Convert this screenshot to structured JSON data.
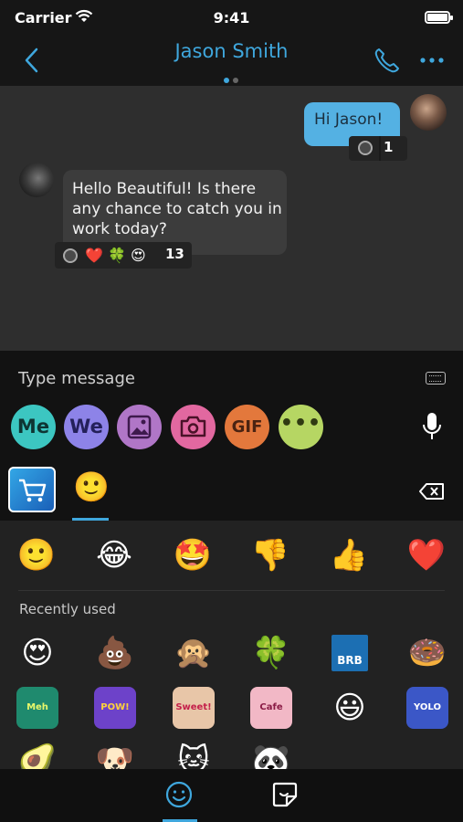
{
  "status_bar": {
    "carrier": "Carrier",
    "time": "9:41"
  },
  "header": {
    "title": "Jason Smith",
    "page_dots": 2,
    "active_dot": 0,
    "accent": "#3fa7dd"
  },
  "messages": [
    {
      "direction": "outgoing",
      "text": "Hi Jason!",
      "reaction_count": "1",
      "reaction_icons": [
        "camera-sticker-icon"
      ]
    },
    {
      "direction": "incoming",
      "text": "Hello Beautiful! Is there any chance to catch you in work today?",
      "reaction_count": "13",
      "reaction_icons": [
        "camera-sticker-icon",
        "❤️",
        "🍀",
        "😍"
      ]
    }
  ],
  "composer": {
    "placeholder": "Type message",
    "actions": [
      {
        "label": "Me",
        "color": "#3cc6c1"
      },
      {
        "label": "We",
        "color": "#8d83e8"
      },
      {
        "icon": "image-icon",
        "color": "#b076c7"
      },
      {
        "icon": "camera-icon",
        "color": "#e268a0"
      },
      {
        "label": "GIF",
        "color": "#e3783c"
      },
      {
        "label": "•••",
        "color": "#b6d663"
      }
    ]
  },
  "keyboard_tabs": {
    "store_icon": "shopping-cart-icon",
    "emoji_tab": "🙂"
  },
  "emoji_panel": {
    "quick": [
      "🙂",
      "😂",
      "🤩",
      "👎",
      "👍",
      "❤️"
    ],
    "recent_label": "Recently used",
    "recent": [
      [
        "😍",
        "💩",
        "🙊",
        "🍀",
        "BRB",
        "🍩"
      ],
      [
        "Meh",
        "POW!",
        "Sweet!",
        "Cafe",
        "😃",
        "YOLO"
      ],
      [
        "🥑",
        "🐶",
        "🐱",
        "🐼"
      ]
    ]
  }
}
